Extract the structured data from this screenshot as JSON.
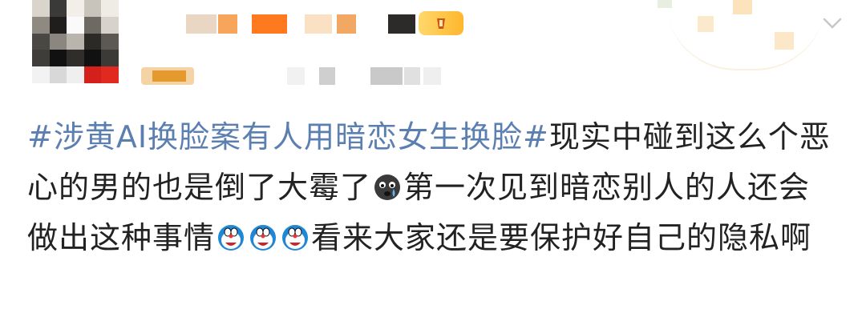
{
  "post": {
    "topic": "#涉黄AI换脸案有人用暗恋女生换脸#",
    "text_part1": "现实中碰到这么个恶心的男的也是倒了大霉了",
    "emoji1": "crying-face-icon",
    "text_part2": "第一次见到暗恋别人的人还会做出这种事情",
    "emoji2": "doraemon-crying-icon",
    "text_part3": "看来大家还是要保护好自己的隐私啊"
  },
  "colors": {
    "topic": "#5a7fb0",
    "text": "#222222",
    "badge": "#ffc23a"
  },
  "header": {
    "badge_icon": "vip-badge-icon",
    "more_icon": "more-chevron-icon"
  }
}
